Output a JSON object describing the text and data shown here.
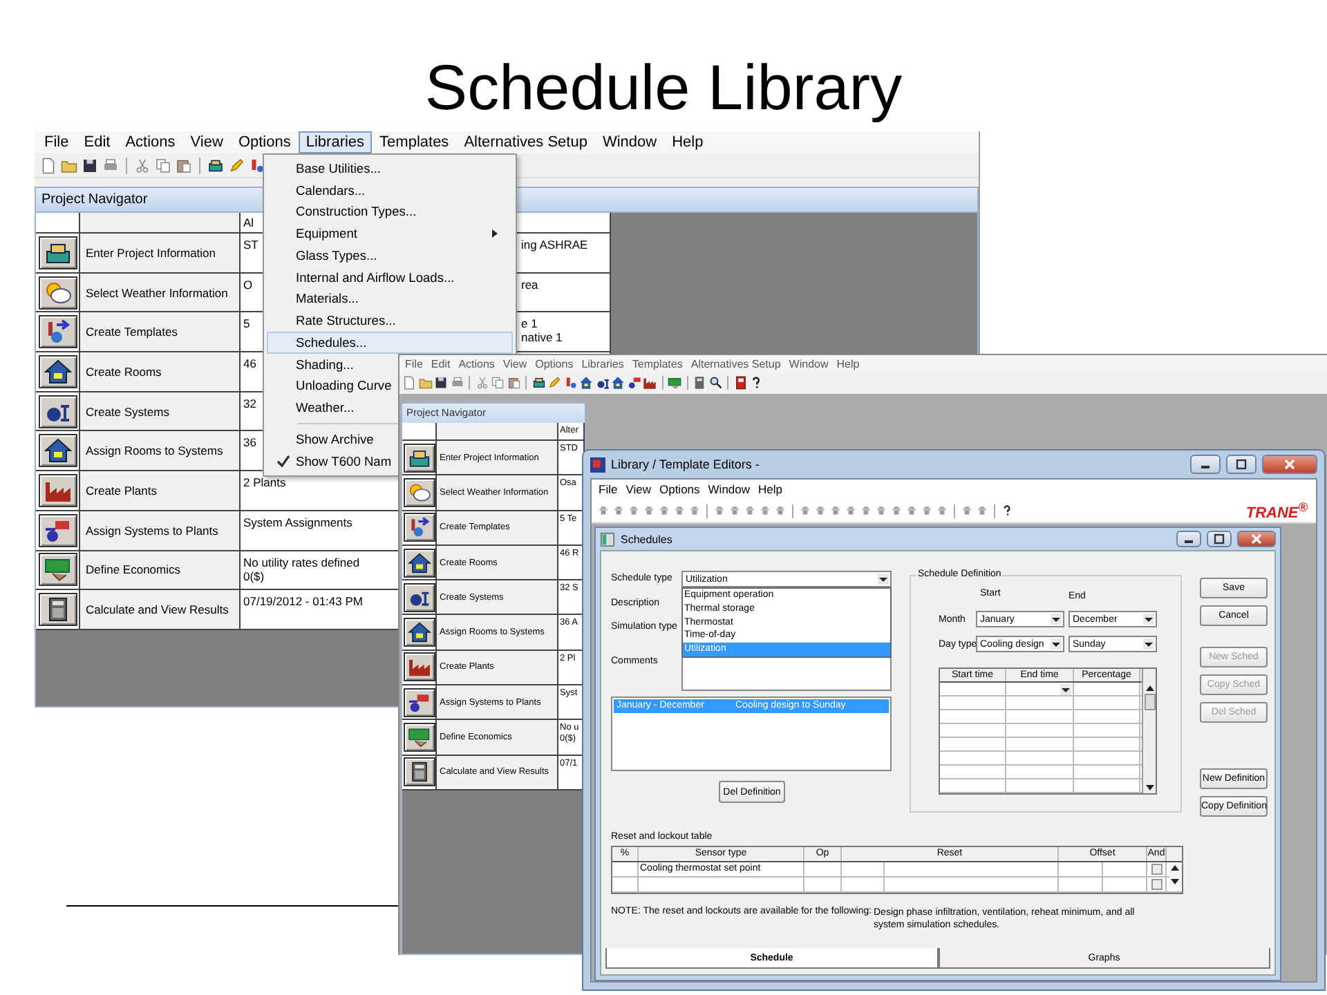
{
  "slide_title": "Schedule Library",
  "back_app": {
    "menu": [
      {
        "label": "File",
        "selected": false
      },
      {
        "label": "Edit",
        "selected": false
      },
      {
        "label": "Actions",
        "selected": false
      },
      {
        "label": "View",
        "selected": false
      },
      {
        "label": "Options",
        "selected": false
      },
      {
        "label": "Libraries",
        "selected": true
      },
      {
        "label": "Templates",
        "selected": false
      },
      {
        "label": "Alternatives Setup",
        "selected": false
      },
      {
        "label": "Window",
        "selected": false
      },
      {
        "label": "Help",
        "selected": false
      }
    ],
    "navigator": {
      "title": "Project Navigator",
      "value_header": "Al",
      "rows": [
        {
          "name": "Enter Project Information",
          "value": [
            "ST"
          ],
          "value_right": [
            "ing ASHRAE"
          ]
        },
        {
          "name": "Select Weather Information",
          "value": [
            "O"
          ],
          "value_right": [
            "rea"
          ]
        },
        {
          "name": "Create Templates",
          "value": [
            "5"
          ],
          "value_right": [
            "e 1",
            "native 1"
          ]
        },
        {
          "name": "Create Rooms",
          "value": [
            "46"
          ]
        },
        {
          "name": "Create Systems",
          "value": [
            "32"
          ]
        },
        {
          "name": "Assign Rooms to Systems",
          "value": [
            "36"
          ]
        },
        {
          "name": "Create Plants",
          "value": [
            "2 Plants"
          ]
        },
        {
          "name": "Assign Systems to Plants",
          "value": [
            "System Assignments"
          ]
        },
        {
          "name": "Define Economics",
          "value": [
            "No utility rates defined",
            "0($)"
          ]
        },
        {
          "name": "Calculate and View Results",
          "value": [
            "07/19/2012 - 01:43 PM"
          ]
        }
      ]
    }
  },
  "libraries_menu": [
    {
      "kind": "item",
      "label": "Base Utilities...",
      "selected": false,
      "checked": false
    },
    {
      "kind": "item",
      "label": "Calendars...",
      "selected": false,
      "checked": false
    },
    {
      "kind": "item",
      "label": "Construction Types...",
      "selected": false,
      "checked": false
    },
    {
      "kind": "submenu",
      "label": "Equipment",
      "selected": false,
      "checked": false
    },
    {
      "kind": "item",
      "label": "Glass Types...",
      "selected": false,
      "checked": false
    },
    {
      "kind": "item",
      "label": "Internal and Airflow Loads...",
      "selected": false,
      "checked": false
    },
    {
      "kind": "item",
      "label": "Materials...",
      "selected": false,
      "checked": false
    },
    {
      "kind": "item",
      "label": "Rate Structures...",
      "selected": false,
      "checked": false
    },
    {
      "kind": "item",
      "label": "Schedules...",
      "selected": true,
      "checked": false
    },
    {
      "kind": "item",
      "label": "Shading...",
      "selected": false,
      "checked": false
    },
    {
      "kind": "item",
      "label": "Unloading Curve",
      "selected": false,
      "checked": false
    },
    {
      "kind": "item",
      "label": "Weather...",
      "selected": false,
      "checked": false
    },
    {
      "kind": "separator"
    },
    {
      "kind": "item",
      "label": "Show Archive",
      "selected": false,
      "checked": false
    },
    {
      "kind": "item",
      "label": "Show T600 Nam",
      "selected": false,
      "checked": true
    }
  ],
  "front_app": {
    "menu": [
      "File",
      "Edit",
      "Actions",
      "View",
      "Options",
      "Libraries",
      "Templates",
      "Alternatives Setup",
      "Window",
      "Help"
    ],
    "navigator": {
      "title": "Project Navigator",
      "value_header": "Alter",
      "rows": [
        {
          "name": "Enter Project Information",
          "value": [
            "STD"
          ]
        },
        {
          "name": "Select Weather Information",
          "value": [
            "Osa"
          ]
        },
        {
          "name": "Create Templates",
          "value": [
            "5 Te"
          ]
        },
        {
          "name": "Create Rooms",
          "value": [
            "46 R"
          ]
        },
        {
          "name": "Create Systems",
          "value": [
            "32 S"
          ]
        },
        {
          "name": "Assign Rooms to Systems",
          "value": [
            "36 A"
          ]
        },
        {
          "name": "Create Plants",
          "value": [
            "2 Pl"
          ]
        },
        {
          "name": "Assign Systems to Plants",
          "value": [
            "Syst"
          ]
        },
        {
          "name": "Define Economics",
          "value": [
            "No u",
            "0($)"
          ]
        },
        {
          "name": "Calculate and View Results",
          "value": [
            "07/1"
          ]
        }
      ]
    },
    "library_window": {
      "title": "Library / Template Editors -",
      "menu": [
        "File",
        "View",
        "Options",
        "Window",
        "Help"
      ],
      "brand": "TRANE$^{®}$",
      "schedules": {
        "title": "Schedules",
        "schedule_type": {
          "label": "Schedule type",
          "value": "Utilization",
          "options": [
            {
              "label": "Equipment operation",
              "selected": false
            },
            {
              "label": "Thermal storage",
              "selected": false
            },
            {
              "label": "Thermostat",
              "selected": false
            },
            {
              "label": "Time-of-day",
              "selected": false
            },
            {
              "label": "Utilization",
              "selected": true
            }
          ]
        },
        "description_label": "Description",
        "simulation_type_label": "Simulation type",
        "comments_label": "Comments",
        "definitions": [
          {
            "months": "January - December",
            "days": "Cooling design to Sunday",
            "selected": true
          }
        ],
        "del_definition": "Del Definition",
        "definition": {
          "title": "Schedule Definition",
          "start_label": "Start",
          "end_label": "End",
          "month_label": "Month",
          "month_start": "January",
          "month_end": "December",
          "day_type_label": "Day type",
          "day_start": "Cooling design",
          "day_end": "Sunday",
          "grid_columns": [
            "Start time",
            "End time",
            "Percentage"
          ]
        },
        "buttons": [
          {
            "label": "Save",
            "disabled": false
          },
          {
            "label": "Cancel",
            "disabled": false
          }
        ],
        "schedule_buttons": [
          {
            "label": "New Sched",
            "disabled": true
          },
          {
            "label": "Copy Sched",
            "disabled": true
          },
          {
            "label": "Del Sched",
            "disabled": true
          }
        ],
        "definition_buttons": [
          {
            "label": "New Definition",
            "disabled": false
          },
          {
            "label": "Copy Definition",
            "disabled": false
          }
        ],
        "reset_table": {
          "title": "Reset and lockout table",
          "columns": [
            "%",
            "Sensor type",
            "Op",
            "Reset",
            "Offset",
            "And"
          ],
          "rows": [
            {
              "sensor_type": "Cooling thermostat set point",
              "and_checked": false
            },
            {
              "and_checked": false
            }
          ]
        },
        "note": "NOTE: The reset and lockouts are available for the following:",
        "note_detail": "Design phase infiltration, ventilation, reheat minimum, and all system simulation schedules.",
        "tabs": [
          {
            "label": "Schedule",
            "selected": true
          },
          {
            "label": "Graphs",
            "selected": false
          }
        ]
      }
    }
  }
}
